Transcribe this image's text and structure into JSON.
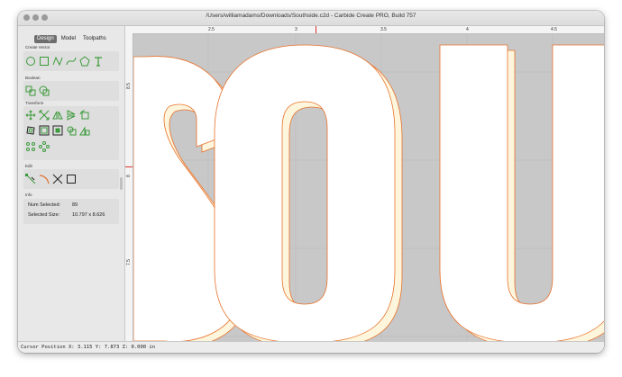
{
  "window": {
    "title": "/Users/williamadams/Downloads/Southside.c2d - Carbide Create PRO, Build 757"
  },
  "sidebar": {
    "tabs": [
      {
        "label": "Design",
        "active": true
      },
      {
        "label": "Model",
        "active": false
      },
      {
        "label": "Toolpaths",
        "active": false
      }
    ],
    "sections": {
      "create_vector": "Create Vector",
      "boolean": "Boolean",
      "transform": "Transform",
      "edit": "Edit",
      "info": "Info"
    },
    "info": {
      "num_selected_label": "Num Selected:",
      "num_selected_value": "89",
      "selected_size_label": "Selected Size:",
      "selected_size_value": "10.797 x 8.626"
    },
    "icons": {
      "create_vector": [
        "circle-icon",
        "rectangle-icon",
        "polyline-icon",
        "curve-icon",
        "polygon-icon",
        "text-icon"
      ],
      "boolean": [
        "join-icon",
        "weld-icon"
      ],
      "transform": [
        "move-icon",
        "scale-icon",
        "mirror-horizontal-icon",
        "mirror-vertical-icon",
        "rotate-icon",
        "offset-icon",
        "align-icon",
        "inset-icon",
        "boundary-icon",
        "group-icon",
        "ungroup-icon",
        "circular-pattern-icon",
        "linear-pattern-icon"
      ],
      "edit": [
        "node-edit-icon",
        "smooth-icon",
        "trim-icon",
        "close-vector-icon"
      ]
    },
    "accent_color": "#3a9a3a"
  },
  "rulers": {
    "top": [
      "2.5",
      "3",
      "3.5",
      "4",
      "4.5"
    ],
    "left": [
      "8.5",
      "8",
      "7.5"
    ]
  },
  "canvas": {
    "letters": [
      "S",
      "O",
      "U"
    ],
    "outline_color": "#e8712c",
    "shadow_color": "#fdf6dc",
    "background": "#c8c8c8"
  },
  "status": {
    "cursor_position": "Cursor Position X: 3.115 Y: 7.873 Z: 0.000 in"
  }
}
